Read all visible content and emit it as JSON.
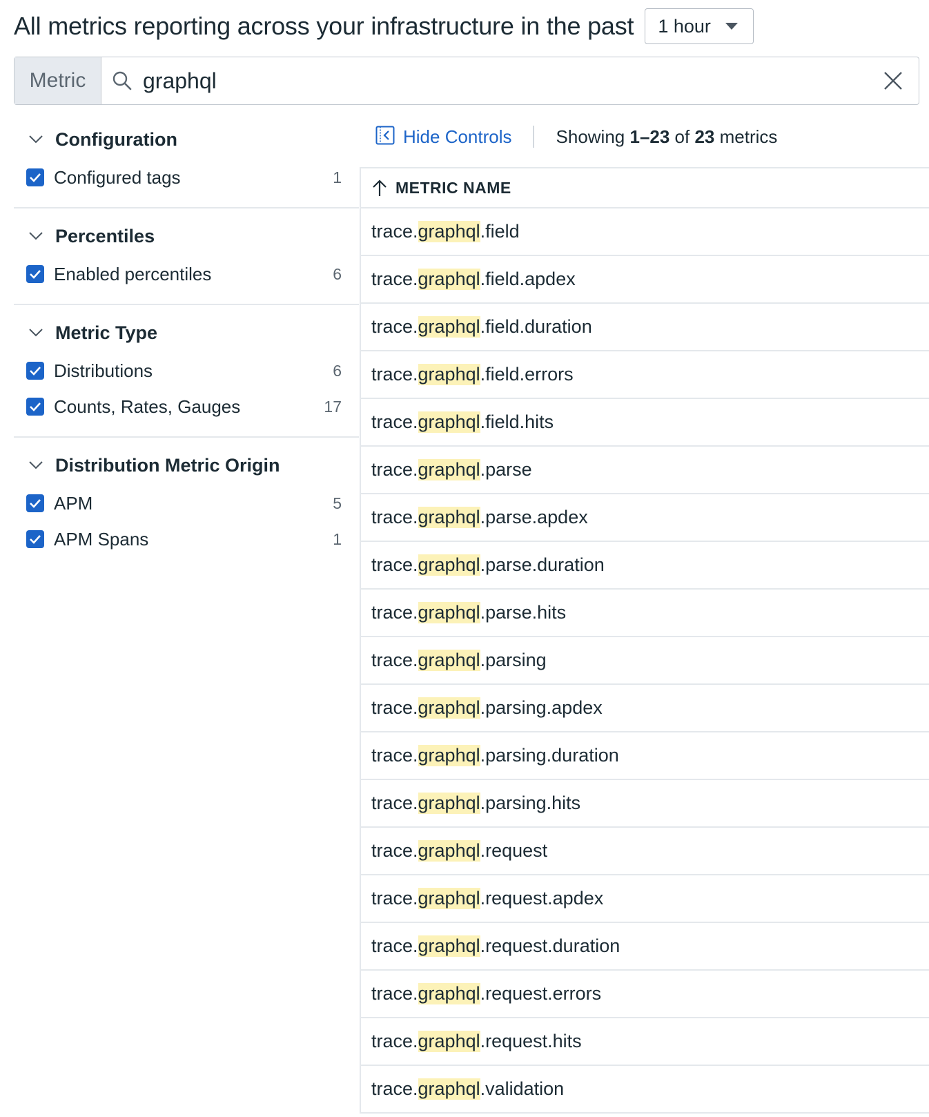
{
  "header": {
    "title": "All metrics reporting across your infrastructure in the past",
    "time_range": "1 hour"
  },
  "search": {
    "prefix": "Metric",
    "value": "graphql"
  },
  "facets": [
    {
      "title": "Configuration",
      "items": [
        {
          "label": "Configured tags",
          "count": "1",
          "checked": true
        }
      ]
    },
    {
      "title": "Percentiles",
      "items": [
        {
          "label": "Enabled percentiles",
          "count": "6",
          "checked": true
        }
      ]
    },
    {
      "title": "Metric Type",
      "items": [
        {
          "label": "Distributions",
          "count": "6",
          "checked": true
        },
        {
          "label": "Counts, Rates, Gauges",
          "count": "17",
          "checked": true
        }
      ]
    },
    {
      "title": "Distribution Metric Origin",
      "items": [
        {
          "label": "APM",
          "count": "5",
          "checked": true
        },
        {
          "label": "APM Spans",
          "count": "1",
          "checked": true
        }
      ]
    }
  ],
  "controls": {
    "hide_label": "Hide Controls",
    "showing_prefix": "Showing ",
    "showing_range": "1–23",
    "showing_mid": " of ",
    "showing_total": "23",
    "showing_suffix": " metrics"
  },
  "table": {
    "column_header": "METRIC NAME",
    "highlight_term": "graphql",
    "rows": [
      {
        "prefix": "trace.",
        "match": "graphql",
        "suffix": ".field"
      },
      {
        "prefix": "trace.",
        "match": "graphql",
        "suffix": ".field.apdex"
      },
      {
        "prefix": "trace.",
        "match": "graphql",
        "suffix": ".field.duration"
      },
      {
        "prefix": "trace.",
        "match": "graphql",
        "suffix": ".field.errors"
      },
      {
        "prefix": "trace.",
        "match": "graphql",
        "suffix": ".field.hits"
      },
      {
        "prefix": "trace.",
        "match": "graphql",
        "suffix": ".parse"
      },
      {
        "prefix": "trace.",
        "match": "graphql",
        "suffix": ".parse.apdex"
      },
      {
        "prefix": "trace.",
        "match": "graphql",
        "suffix": ".parse.duration"
      },
      {
        "prefix": "trace.",
        "match": "graphql",
        "suffix": ".parse.hits"
      },
      {
        "prefix": "trace.",
        "match": "graphql",
        "suffix": ".parsing"
      },
      {
        "prefix": "trace.",
        "match": "graphql",
        "suffix": ".parsing.apdex"
      },
      {
        "prefix": "trace.",
        "match": "graphql",
        "suffix": ".parsing.duration"
      },
      {
        "prefix": "trace.",
        "match": "graphql",
        "suffix": ".parsing.hits"
      },
      {
        "prefix": "trace.",
        "match": "graphql",
        "suffix": ".request"
      },
      {
        "prefix": "trace.",
        "match": "graphql",
        "suffix": ".request.apdex"
      },
      {
        "prefix": "trace.",
        "match": "graphql",
        "suffix": ".request.duration"
      },
      {
        "prefix": "trace.",
        "match": "graphql",
        "suffix": ".request.errors"
      },
      {
        "prefix": "trace.",
        "match": "graphql",
        "suffix": ".request.hits"
      },
      {
        "prefix": "trace.",
        "match": "graphql",
        "suffix": ".validation"
      }
    ]
  },
  "colors": {
    "accent": "#1c64c8",
    "highlight": "#fcf2b8",
    "border": "#e4e8ec"
  }
}
